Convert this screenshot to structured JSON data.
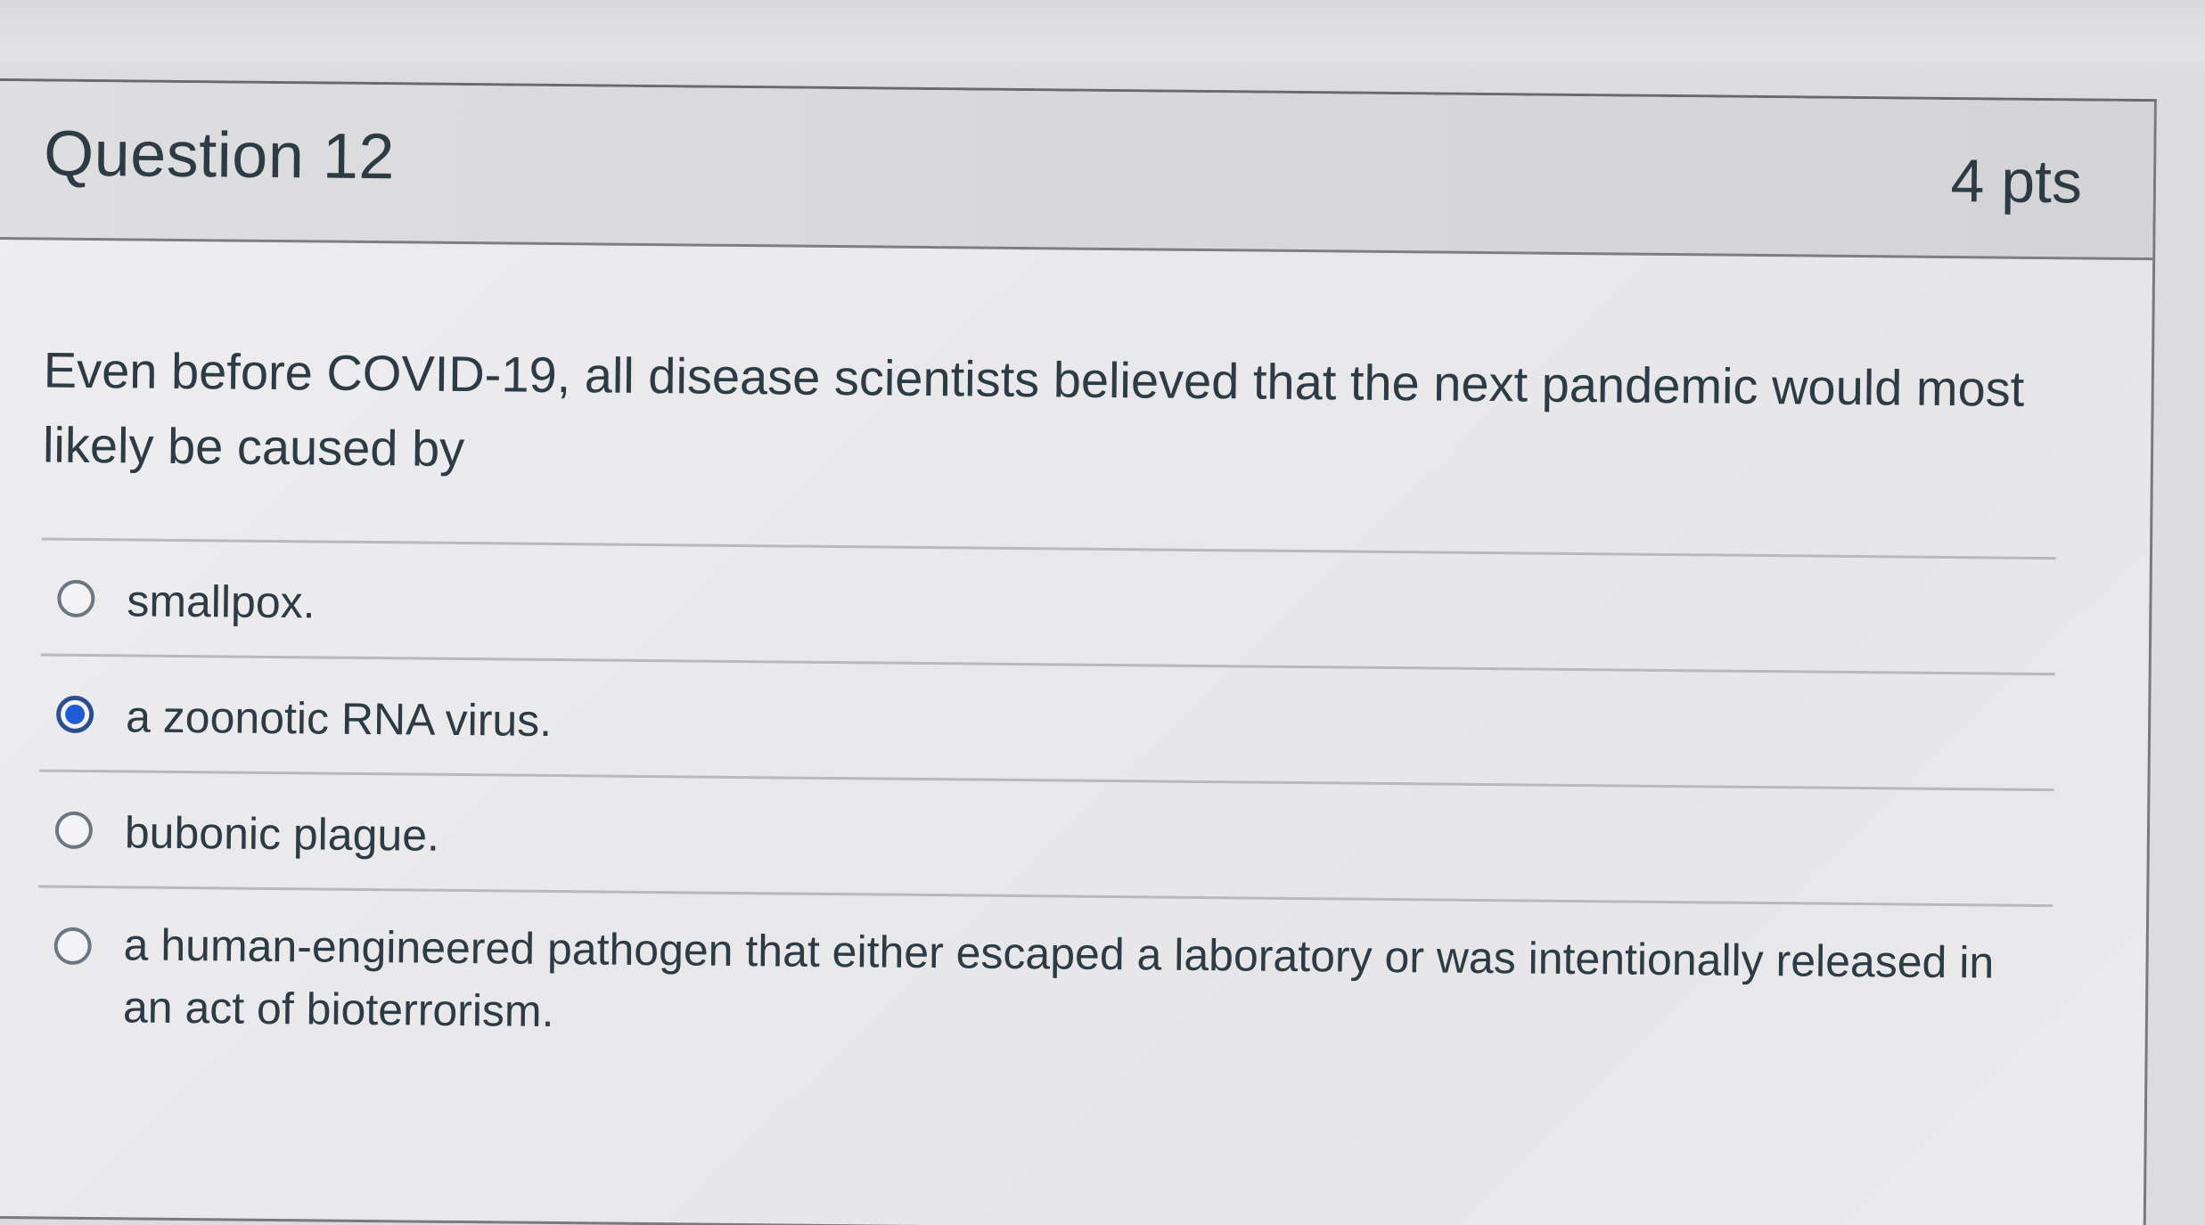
{
  "question": {
    "title": "Question 12",
    "points": "4 pts",
    "text": "Even before COVID-19, all disease scientists believed that the next pandemic would most likely be caused by"
  },
  "answers": [
    {
      "label": "smallpox.",
      "selected": false
    },
    {
      "label": "a zoonotic RNA virus.",
      "selected": true
    },
    {
      "label": "bubonic plague.",
      "selected": false
    },
    {
      "label": "a human-engineered pathogen that either escaped a laboratory or was intentionally released in an act of bioterrorism.",
      "selected": false
    }
  ],
  "colors": {
    "text": "#2d3b45",
    "radio_selected": "#1e5bd6",
    "header_bg": "#d8d8db"
  }
}
